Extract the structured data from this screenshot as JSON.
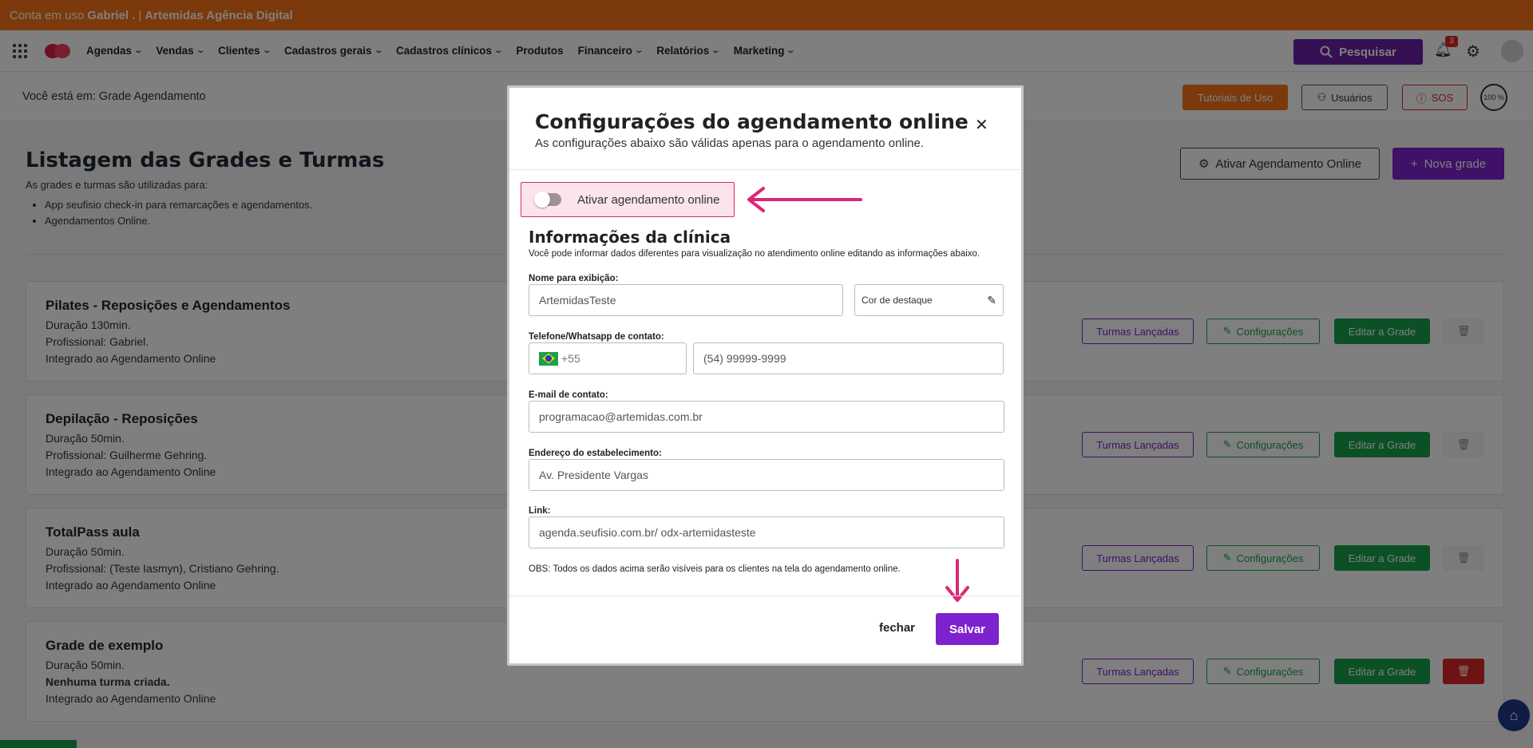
{
  "account_bar": {
    "prefix": "Conta em uso",
    "user": "Gabriel .",
    "separator": "|",
    "company": "Artemidas Agência Digital"
  },
  "nav": {
    "items": [
      {
        "label": "Agendas",
        "dropdown": true
      },
      {
        "label": "Vendas",
        "dropdown": true
      },
      {
        "label": "Clientes",
        "dropdown": true
      },
      {
        "label": "Cadastros gerais",
        "dropdown": true
      },
      {
        "label": "Cadastros clínicos",
        "dropdown": true
      },
      {
        "label": "Produtos",
        "dropdown": false
      },
      {
        "label": "Financeiro",
        "dropdown": true
      },
      {
        "label": "Relatórios",
        "dropdown": true
      },
      {
        "label": "Marketing",
        "dropdown": true
      }
    ],
    "search_label": "Pesquisar",
    "notification_count": "3"
  },
  "breadcrumb": "Você está em: Grade Agendamento",
  "header_buttons": {
    "tutorial": "Tutoriais de Uso",
    "users": "Usuários",
    "sos": "SOS",
    "zoom": "100 %"
  },
  "page": {
    "title": "Listagem das Grades e Turmas",
    "desc": "As grades e turmas são utilizadas para:",
    "bullets": [
      "App seufisio check-in para remarcações e agendamentos.",
      "Agendamentos Online."
    ],
    "activate_online_label": "Ativar Agendamento Online",
    "new_grade_label": "Nova grade"
  },
  "card_buttons": {
    "turmas": "Turmas Lançadas",
    "config": "Configurações",
    "edit": "Editar a Grade"
  },
  "grades": [
    {
      "title": "Pilates - Reposições e Agendamentos",
      "duration": "Duração 130min.",
      "professional": "Profissional: Gabriel.",
      "integrated": "Integrado ao Agendamento Online"
    },
    {
      "title": "Depilação - Reposições",
      "duration": "Duração 50min.",
      "professional": "Profissional: Guilherme Gehring.",
      "integrated": "Integrado ao Agendamento Online"
    },
    {
      "title": "TotalPass aula",
      "duration": "Duração 50min.",
      "professional": "Profissional: (Teste Iasmyn), Cristiano Gehring.",
      "integrated": "Integrado ao Agendamento Online"
    },
    {
      "title": "Grade de exemplo",
      "duration": "Duração 50min.",
      "professional": "Nenhuma turma criada.",
      "integrated": "Integrado ao Agendamento Online"
    }
  ],
  "modal": {
    "title": "Configurações do agendamento online",
    "subtitle": "As configurações abaixo são válidas apenas para o agendamento online.",
    "toggle_label": "Ativar agendamento online",
    "toggle_on": false,
    "section_title": "Informações da clínica",
    "section_desc": "Você pode informar dados diferentes para visualização no atendimento online editando as informações abaixo.",
    "name_label": "Nome para exibição:",
    "name_value": "ArtemidasTeste",
    "color_label": "Cor de destaque",
    "phone_label": "Telefone/Whatsapp de contato:",
    "phone_prefix": "+55",
    "phone_placeholder": "(54) 99999-9999",
    "email_label": "E-mail de contato:",
    "email_value": "programacao@artemidas.com.br",
    "address_label": "Endereço do estabelecimento:",
    "address_value": "Av. Presidente Vargas",
    "link_label": "Link:",
    "link_value": "agenda.seufisio.com.br/ odx-artemidasteste",
    "obs": "OBS: Todos os dados acima serão visíveis para os clientes na tela do agendamento online.",
    "close_label": "fechar",
    "save_label": "Salvar"
  },
  "colors": {
    "brand_purple": "#7e22ce",
    "accent_orange": "#f97316",
    "success_green": "#16a34a",
    "danger_red": "#dc2626",
    "annotation_pink": "#db2777"
  }
}
